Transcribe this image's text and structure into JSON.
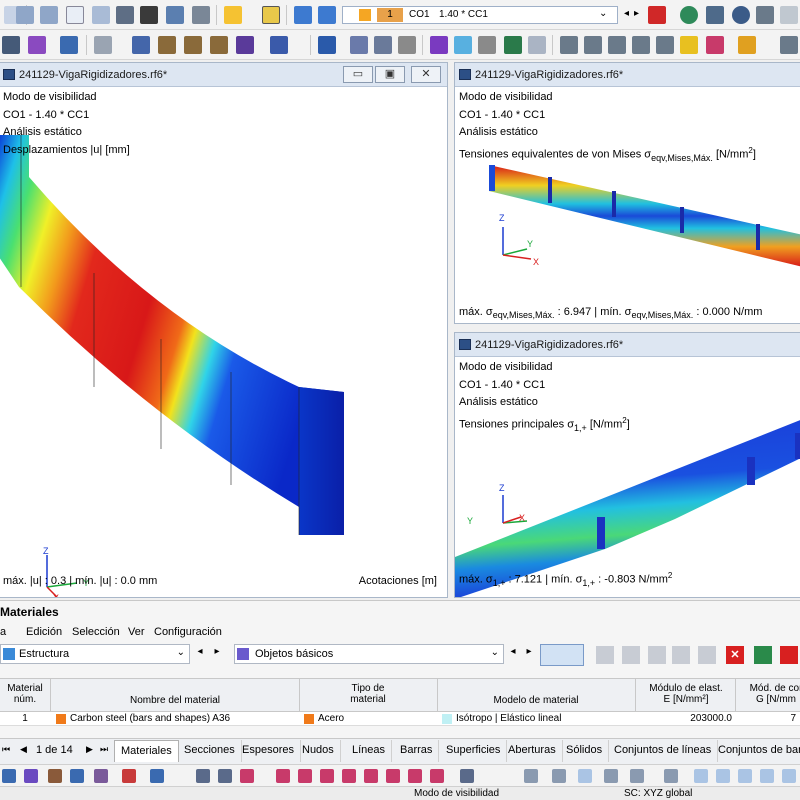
{
  "toolbar": {
    "load_case_number": "1",
    "load_case_code": "CO1",
    "load_case_combo": "1.40 * CC1"
  },
  "windows": {
    "left": {
      "title": "241129-VigaRigidizadores.rf6*",
      "lines": [
        "Modo de visibilidad",
        "CO1 - 1.40 * CC1",
        "Análisis estático",
        "Desplazamientos |u| [mm]"
      ],
      "status_left": "máx. |u| : 0.3 | mín. |u| : 0.0 mm",
      "status_right": "Acotaciones [m]",
      "axes": {
        "z": "Z",
        "y": "Y",
        "x": "X"
      }
    },
    "top_right": {
      "title": "241129-VigaRigidizadores.rf6*",
      "lines": [
        "Modo de visibilidad",
        "CO1 - 1.40 * CC1",
        "Análisis estático"
      ],
      "result_label": "Tensiones equivalentes de von Mises σ",
      "result_sub": "eqv,Mises,Máx.",
      "result_unit": "[N/mm",
      "result_sup": "2",
      "result_close": "]",
      "status_a": "máx. σ",
      "status_sub1": "eqv,Mises,Máx.",
      "status_b": " : 6.947 | mín. σ",
      "status_sub2": "eqv,Mises,Máx.",
      "status_c": " : 0.000 N/mm",
      "axes": {
        "z": "Z",
        "y": "Y",
        "x": "X"
      }
    },
    "bottom_right": {
      "title": "241129-VigaRigidizadores.rf6*",
      "lines": [
        "Modo de visibilidad",
        "CO1 - 1.40 * CC1",
        "Análisis estático"
      ],
      "result_label": "Tensiones principales σ",
      "result_sub": "1,+",
      "result_unit": "[N/mm",
      "result_sup": "2",
      "result_close": "]",
      "status_a": "máx. σ",
      "status_sub1": "1,+",
      "status_b": " : 7.121 | mín. σ",
      "status_sub2": "1,+",
      "status_c": " : -0.803 N/mm",
      "status_sup": "2",
      "axes": {
        "z": "Z",
        "y": "Y",
        "x": "X"
      }
    }
  },
  "panel": {
    "title": "Materiales",
    "menu": [
      "a",
      "Edición",
      "Selección",
      "Ver",
      "Configuración"
    ],
    "filter1": "Estructura",
    "filter2": "Objetos básicos",
    "columns": [
      {
        "line1": "Material",
        "line2": "núm."
      },
      {
        "line1": "",
        "line2": "Nombre del material"
      },
      {
        "line1": "Tipo de",
        "line2": "material"
      },
      {
        "line1": "",
        "line2": "Modelo de material"
      },
      {
        "line1": "Módulo de elast.",
        "line2": "E [N/mm²]"
      },
      {
        "line1": "Mód. de cor",
        "line2": "G [N/mm"
      }
    ],
    "row": {
      "num": "1",
      "name": "Carbon steel (bars and shapes) A36",
      "type": "Acero",
      "model": "Isótropo | Elástico lineal",
      "e": "203000.0",
      "g": "7"
    },
    "pager": "1 de 14",
    "tabs": [
      "Materiales",
      "Secciones",
      "Espesores",
      "Nudos",
      "Líneas",
      "Barras",
      "Superficies",
      "Aberturas",
      "Sólidos",
      "Conjuntos de líneas",
      "Conjuntos de barr"
    ]
  },
  "statusbar": {
    "mode": "Modo de visibilidad",
    "cs": "SC: XYZ global"
  },
  "colors": {
    "title_bg": "#dde6f2",
    "accent": "#2c4f86",
    "material_orange": "#f07a1a",
    "isotropic_cyan": "#bff0f4"
  }
}
